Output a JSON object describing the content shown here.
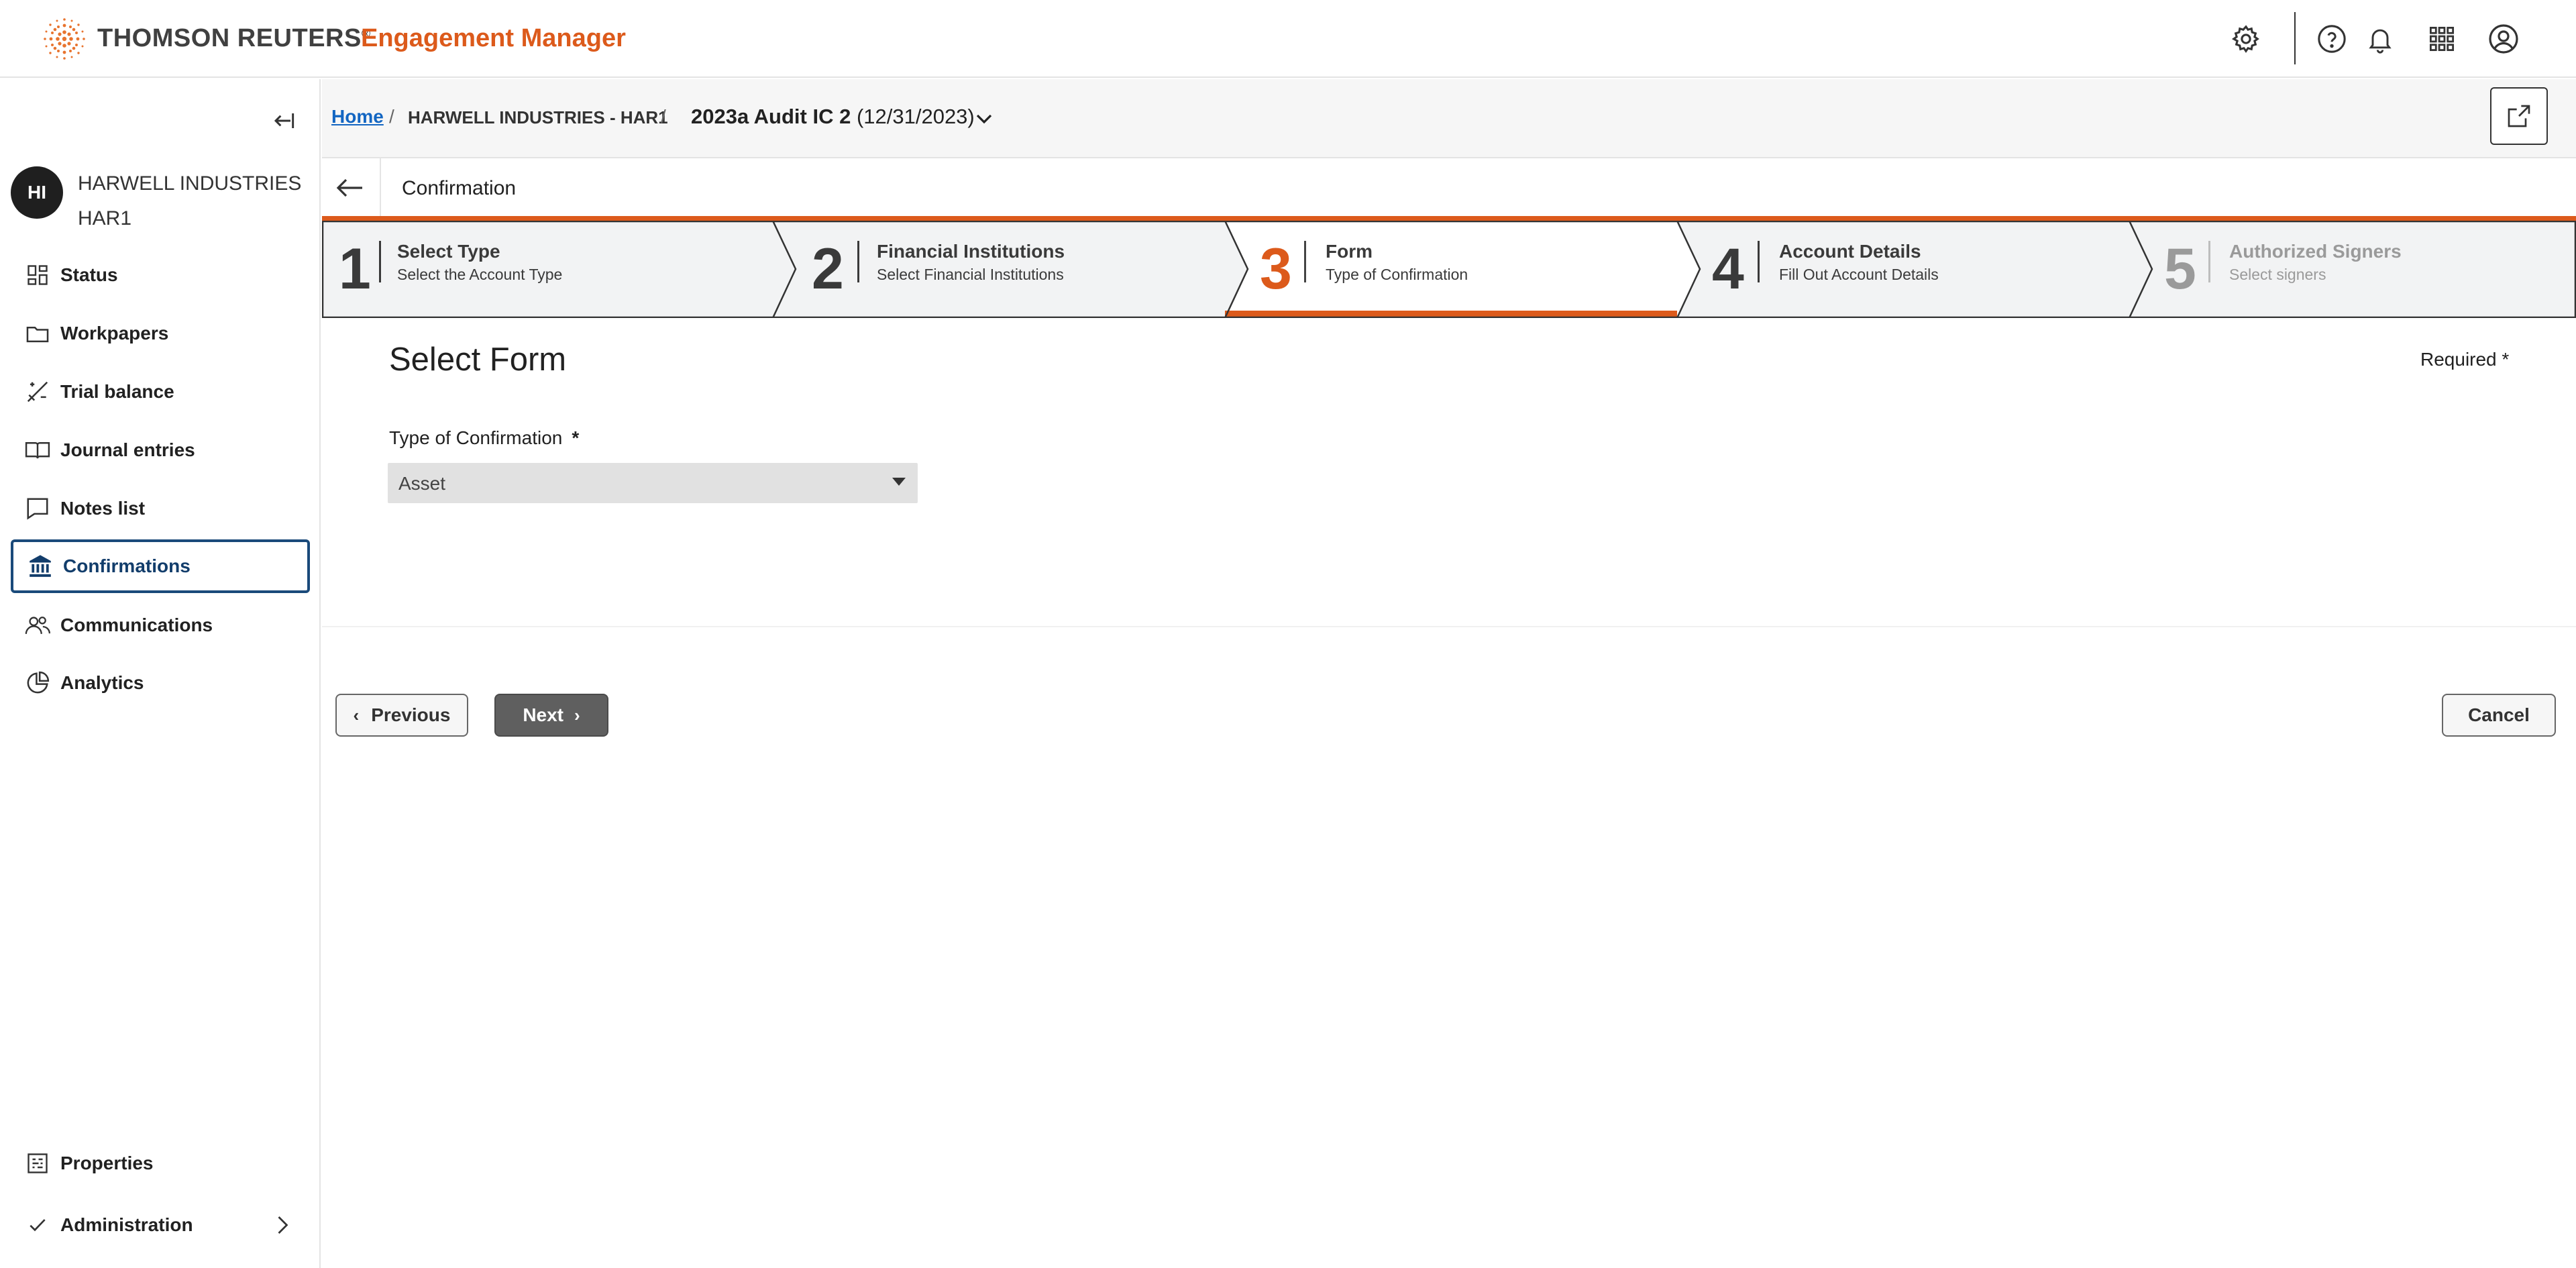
{
  "header": {
    "brand": "THOMSON REUTERS",
    "brand_mark": "®",
    "product": "Engagement Manager",
    "icons": [
      "gear-icon",
      "help-icon",
      "bell-icon",
      "apps-grid-icon",
      "user-account-icon"
    ]
  },
  "sidebar": {
    "collapse_icon": "collapse-left-icon",
    "client": {
      "initials": "HI",
      "name_line1": "HARWELL INDUSTRIES",
      "name_line2": "HAR1"
    },
    "items": [
      {
        "label": "Status",
        "icon": "dashboard-icon"
      },
      {
        "label": "Workpapers",
        "icon": "folder-icon"
      },
      {
        "label": "Trial balance",
        "icon": "trial-balance-icon"
      },
      {
        "label": "Journal entries",
        "icon": "book-icon"
      },
      {
        "label": "Notes list",
        "icon": "comment-icon"
      },
      {
        "label": "Confirmations",
        "icon": "bank-icon",
        "active": true
      },
      {
        "label": "Communications",
        "icon": "people-icon"
      },
      {
        "label": "Analytics",
        "icon": "pie-chart-icon"
      }
    ],
    "bottom_items": [
      {
        "label": "Properties",
        "icon": "properties-icon"
      },
      {
        "label": "Administration",
        "icon": "check-icon"
      }
    ]
  },
  "breadcrumb": {
    "home": "Home",
    "separator": "/",
    "client": "HARWELL INDUSTRIES - HAR1",
    "engagement_name": "2023a Audit IC 2",
    "engagement_date": "(12/31/2023)"
  },
  "page": {
    "title": "Confirmation"
  },
  "stepper": {
    "current_step": 3,
    "steps": [
      {
        "number": "1",
        "title": "Select Type",
        "subtitle": "Select the Account Type"
      },
      {
        "number": "2",
        "title": "Financial Institutions",
        "subtitle": "Select Financial Institutions"
      },
      {
        "number": "3",
        "title": "Form",
        "subtitle": "Type of Confirmation"
      },
      {
        "number": "4",
        "title": "Account Details",
        "subtitle": "Fill Out Account Details"
      },
      {
        "number": "5",
        "title": "Authorized Signers",
        "subtitle": "Select signers"
      }
    ]
  },
  "form": {
    "title": "Select Form",
    "required_note": "Required *",
    "type_label": "Type of Confirmation",
    "required_mark": "*",
    "type_value": "Asset"
  },
  "buttons": {
    "previous": "Previous",
    "next": "Next",
    "cancel": "Cancel"
  },
  "colors": {
    "accent": "#dc5a1b",
    "active_nav": "#1a4a7a",
    "link": "#1366c2",
    "primary_button": "#5f5f5f"
  }
}
